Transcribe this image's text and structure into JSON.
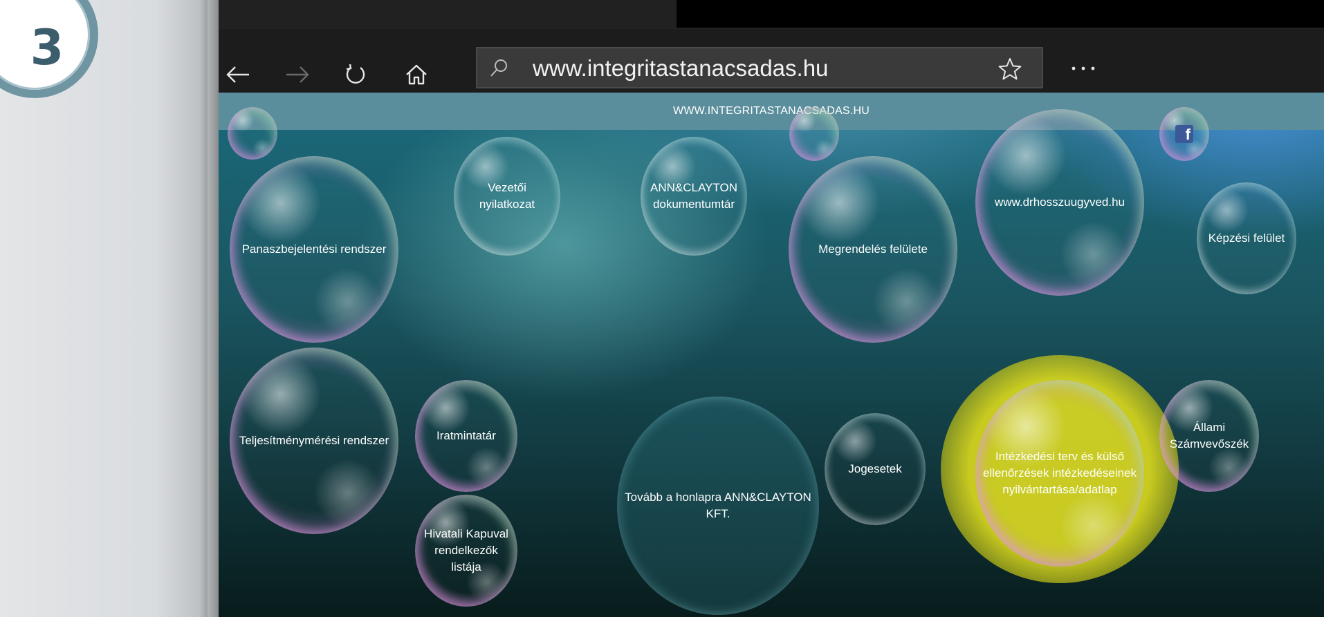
{
  "step": {
    "number": "3"
  },
  "browser": {
    "toolbar": {
      "back_label": "Back",
      "forward_label": "Forward",
      "refresh_label": "Refresh",
      "home_label": "Home",
      "favorite_label": "Favorite",
      "more_label": "More"
    },
    "address_bar": {
      "url": "www.integritastanacsadas.hu"
    }
  },
  "site": {
    "header_title": "WWW.INTEGRITASTANACSADAS.HU",
    "bubbles": [
      {
        "id": "panasz",
        "label": "Panaszbejelentési rendszer"
      },
      {
        "id": "vezetoi",
        "label": "Vezetői nyilatkozat"
      },
      {
        "id": "annclayton-docs",
        "label": "ANN&CLAYTON dokumentumtár"
      },
      {
        "id": "megrendeles",
        "label": "Megrendelés felülete"
      },
      {
        "id": "drhosszu",
        "label": "www.drhosszuugyved.hu"
      },
      {
        "id": "kepzesi",
        "label": "Képzési felület"
      },
      {
        "id": "teljesitmeny",
        "label": "Teljesítménymérési rendszer"
      },
      {
        "id": "iratmintatar",
        "label": "Iratmintatár"
      },
      {
        "id": "hivatali-kapu",
        "label": "Hivatali Kapuval rendelkezők listája"
      },
      {
        "id": "tovabb",
        "label": "Tovább a honlapra ANN&CLAYTON KFT."
      },
      {
        "id": "jogesetek",
        "label": "Jogesetek"
      },
      {
        "id": "intezkedesi",
        "label": "Intézkedési terv és külső ellenőrzések intézkedéseinek nyilvántartása/adatlap"
      },
      {
        "id": "allami",
        "label": "Állami Számvevőszék"
      }
    ]
  },
  "colors": {
    "header_bar": "#5b8e9c",
    "highlight_halo": "#d2d21e",
    "badge_ring": "#6f95a3",
    "facebook": "#3b5998"
  }
}
